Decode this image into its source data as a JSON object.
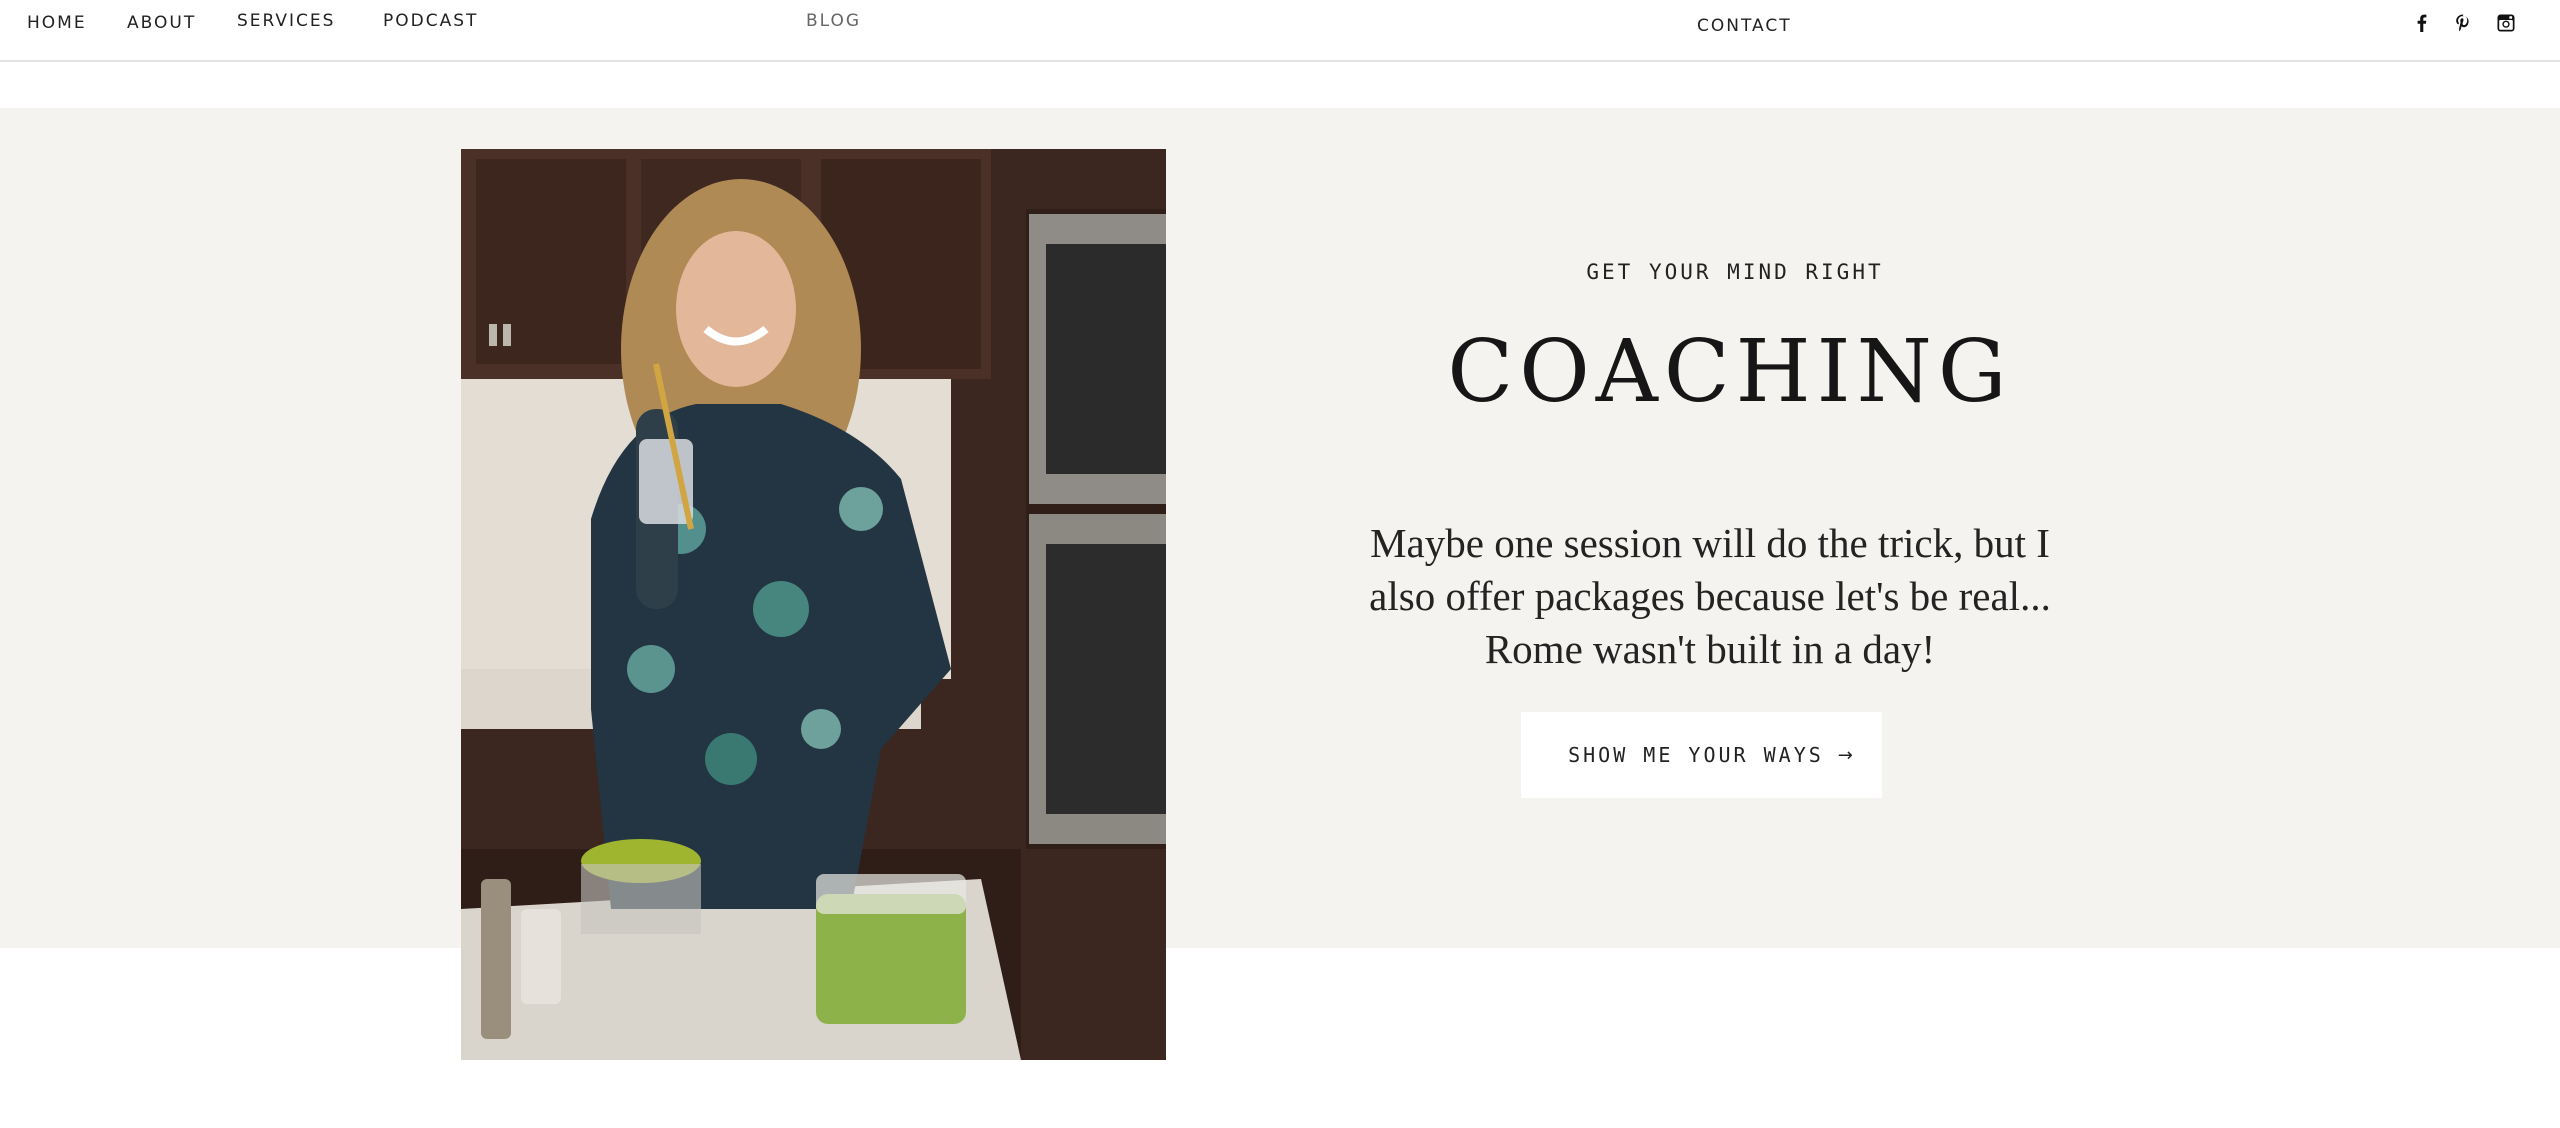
{
  "nav": {
    "items": [
      {
        "label": "HOME"
      },
      {
        "label": "ABOUT"
      },
      {
        "label": "SERVICES"
      },
      {
        "label": "PODCAST"
      },
      {
        "label": "BLOG"
      },
      {
        "label": "CONTACT"
      }
    ],
    "social": [
      {
        "icon": "facebook-icon"
      },
      {
        "icon": "pinterest-icon"
      },
      {
        "icon": "instagram-icon"
      }
    ]
  },
  "hero": {
    "eyebrow": "GET YOUR MIND RIGHT",
    "heading": "COACHING",
    "body": "Maybe one session will do the trick, but I also offer packages because let's be real... Rome wasn't built in a day!",
    "cta_label": "SHOW ME YOUR WAYS",
    "cta_arrow": "→"
  },
  "colors": {
    "band_background": "#f5f3ef",
    "text": "#1d1d1d",
    "button_background": "#ffffff"
  }
}
